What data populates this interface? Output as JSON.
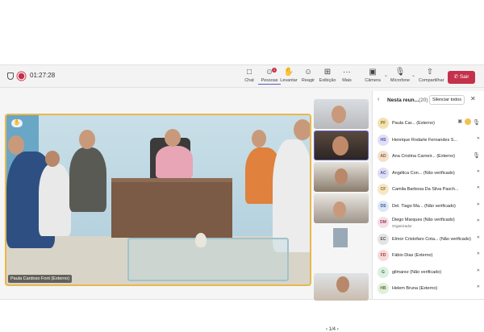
{
  "toolbar": {
    "timer": "01:27:28",
    "buttons": [
      {
        "label": "Chat",
        "icon": "chat-icon"
      },
      {
        "label": "Pessoas",
        "icon": "people-icon"
      },
      {
        "label": "Levantar",
        "icon": "hand-icon"
      },
      {
        "label": "Reagir",
        "icon": "smile-icon"
      },
      {
        "label": "Exibição",
        "icon": "grid-icon"
      },
      {
        "label": "Mais",
        "icon": "more-icon"
      },
      {
        "label": "Câmera",
        "icon": "camera-off-icon"
      },
      {
        "label": "Microfone",
        "icon": "mic-off-icon"
      },
      {
        "label": "Compartilhar",
        "icon": "share-icon"
      }
    ],
    "leave_label": "Sair",
    "people_badge": "1"
  },
  "stage": {
    "name_tag": "Paula Cardoso Font (Externo)",
    "hand_emoji": "✋"
  },
  "thumbnails": {
    "pager": "1/4"
  },
  "panel": {
    "title": "Nesta reun...",
    "count": "(20)",
    "mute_all": "Silenciar todos",
    "participants": [
      {
        "initials": "PF",
        "name": "Paula Car...",
        "tag": "(Externo)",
        "color": "#f2e2b3",
        "text_color": "#8a6d1c"
      },
      {
        "initials": "HS",
        "name": "Henrique Rodarte Fernandes S...",
        "tag": "",
        "color": "#e1dff3",
        "text_color": "#4f52b2"
      },
      {
        "initials": "AD",
        "name": "Ana Cristina Carneir...",
        "tag": "(Externo)",
        "color": "#f4e0cf",
        "text_color": "#8f5a2d"
      },
      {
        "initials": "AC",
        "name": "Angélica Con...",
        "tag": "(Não verificado)",
        "color": "#e1dff3",
        "text_color": "#4f52b2"
      },
      {
        "initials": "CF",
        "name": "Camila Barbosa Da Silva Pasch...",
        "tag": "",
        "color": "#f6e7c7",
        "text_color": "#8a6d1c"
      },
      {
        "initials": "DS",
        "name": "Del. Tiago Ma...",
        "tag": "(Não verificado)",
        "color": "#dde7f6",
        "text_color": "#2b5797"
      },
      {
        "initials": "DM",
        "name": "Diego Marques (Não verificado)",
        "tag": "",
        "sub": "Organizador",
        "color": "#f3dfe6",
        "text_color": "#a33a5c"
      },
      {
        "initials": "EC",
        "name": "Elmor Cristofaro Cota...",
        "tag": "(Não verificado)",
        "color": "#e4e4e4",
        "text_color": "#555555"
      },
      {
        "initials": "FD",
        "name": "Fábio Dias (Externo)",
        "tag": "",
        "color": "#f6dada",
        "text_color": "#a33a3a"
      },
      {
        "initials": "G",
        "name": "gilmarez (Não verificado)",
        "tag": "",
        "color": "#dcefe0",
        "text_color": "#2f7a45"
      },
      {
        "initials": "HB",
        "name": "Helem Bruna (Externo)",
        "tag": "",
        "color": "#e3eedc",
        "text_color": "#4f7a2f"
      }
    ]
  }
}
